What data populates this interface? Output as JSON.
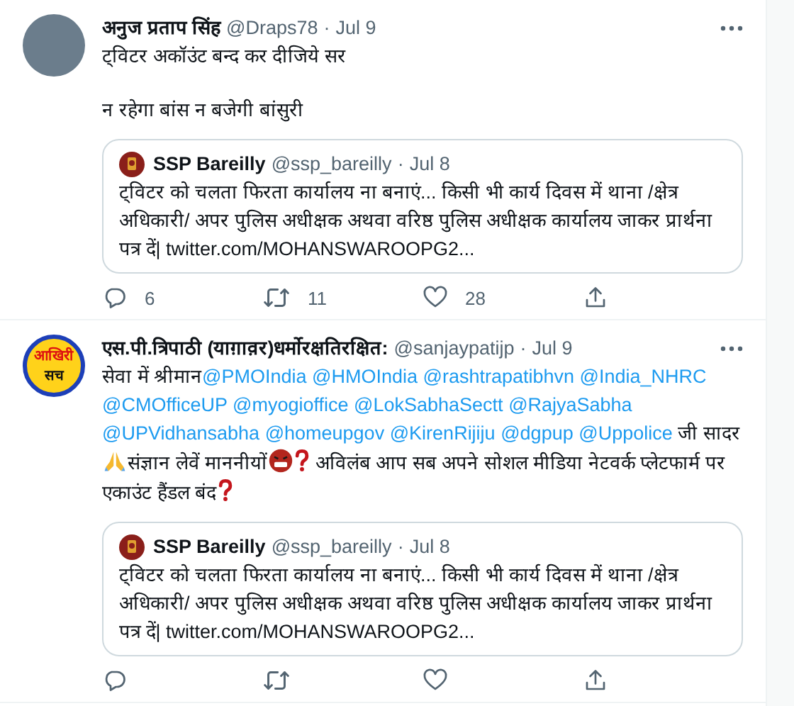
{
  "tweets": [
    {
      "avatar": {
        "kind": "photo"
      },
      "name": "अनुज प्रताप सिंह",
      "handle": "@Draps78",
      "separator": "·",
      "date": "Jul 9",
      "paragraphs": [
        [
          {
            "kind": "text",
            "text": "ट्विटर अकॉउंट बन्द कर दीजिये सर"
          }
        ],
        [
          {
            "kind": "text",
            "text": "न रहेगा बांस न बजेगी बांसुरी"
          }
        ]
      ],
      "quote": {
        "name": "SSP Bareilly",
        "handle": "@ssp_bareilly",
        "separator": "·",
        "date": "Jul 8",
        "text": "ट्विटर को चलता फिरता कार्यालय ना बनाएं... किसी भी कार्य दिवस में थाना /क्षेत्र अधिकारी/ अपर पुलिस अधीक्षक अथवा वरिष्ठ पुलिस अधीक्षक कार्यालय जाकर प्रार्थना पत्र दें|",
        "link": "twitter.com/MOHANSWAROOPG2..."
      },
      "actions": [
        {
          "kind": "reply",
          "count": "6"
        },
        {
          "kind": "retweet",
          "count": "11"
        },
        {
          "kind": "like",
          "count": "28"
        },
        {
          "kind": "share"
        }
      ]
    },
    {
      "avatar": {
        "kind": "logo",
        "lines": [
          "आखिरी",
          "सच"
        ]
      },
      "name": "एस.पी.त्रिपाठी (याग़ाव़र)धर्मोरक्षतिरक्षित:",
      "handle": "@sanjaypatijp",
      "separator": "·",
      "date": "Jul 9",
      "paragraphs": [
        [
          {
            "kind": "text",
            "text": "सेवा में श्रीमान"
          },
          {
            "kind": "mention",
            "text": "@PMOIndia"
          },
          {
            "kind": "mention",
            "text": "@HMOIndia"
          },
          {
            "kind": "mention",
            "text": "@rashtrapatibhvn"
          },
          {
            "kind": "mention",
            "text": "@India_NHRC"
          },
          {
            "kind": "mention",
            "text": "@CMOfficeUP"
          },
          {
            "kind": "mention",
            "text": "@myogioffice"
          },
          {
            "kind": "mention",
            "text": "@LokSabhaSectt"
          },
          {
            "kind": "mention",
            "text": "@RajyaSabha"
          },
          {
            "kind": "mention",
            "text": "@UPVidhansabha"
          },
          {
            "kind": "mention",
            "text": "@homeupgov"
          },
          {
            "kind": "mention",
            "text": "@KirenRijiju"
          },
          {
            "kind": "mention",
            "text": "@dgpup"
          },
          {
            "kind": "mention",
            "text": "@Uppolice"
          },
          {
            "kind": "text",
            "text": " जी सादर "
          },
          {
            "kind": "pray"
          },
          {
            "kind": "text",
            "text": "संज्ञान लेवें माननीयों"
          },
          {
            "kind": "angry"
          },
          {
            "kind": "question"
          },
          {
            "kind": "text",
            "text": "  अविलंब आप सब अपने सोशल मीडिया नेटवर्क प्लेटफार्म पर एकाउंट हैंडल बंद"
          },
          {
            "kind": "question"
          }
        ]
      ],
      "quote": {
        "name": "SSP Bareilly",
        "handle": "@ssp_bareilly",
        "separator": "·",
        "date": "Jul 8",
        "text": "ट्विटर को चलता फिरता कार्यालय ना बनाएं... किसी भी कार्य दिवस में थाना /क्षेत्र अधिकारी/ अपर पुलिस अधीक्षक अथवा वरिष्ठ पुलिस अधीक्षक कार्यालय जाकर प्रार्थना पत्र दें|",
        "link": "twitter.com/MOHANSWAROOPG2..."
      },
      "actions": [
        {
          "kind": "reply"
        },
        {
          "kind": "retweet"
        },
        {
          "kind": "like"
        },
        {
          "kind": "share"
        }
      ]
    }
  ]
}
